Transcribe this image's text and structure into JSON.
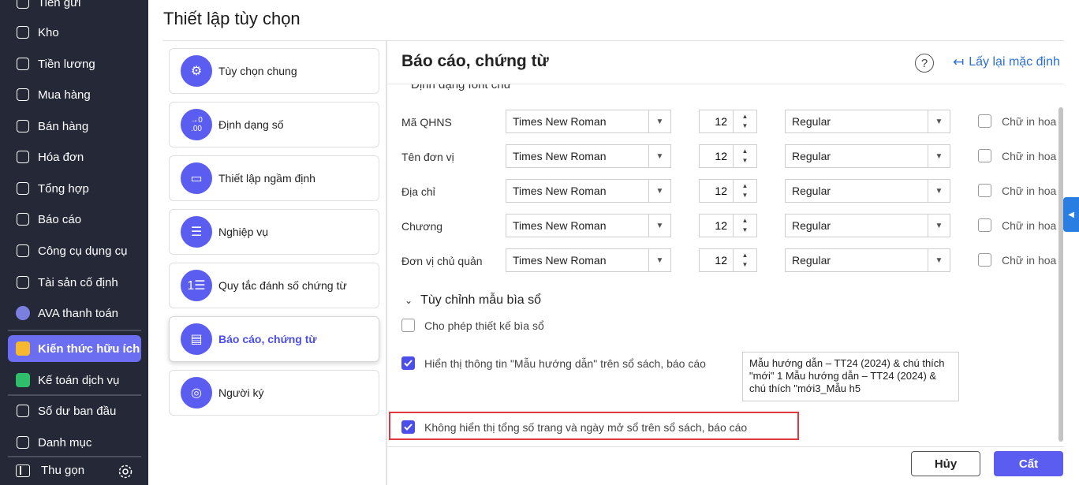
{
  "sidebar": {
    "items": [
      {
        "label": "Tiền gửi",
        "icon": "bank-icon"
      },
      {
        "label": "Kho",
        "icon": "warehouse-icon"
      },
      {
        "label": "Tiền lương",
        "icon": "salary-icon"
      },
      {
        "label": "Mua hàng",
        "icon": "cart-icon"
      },
      {
        "label": "Bán hàng",
        "icon": "store-icon"
      },
      {
        "label": "Hóa đơn",
        "icon": "invoice-icon"
      },
      {
        "label": "Tổng hợp",
        "icon": "summary-icon"
      },
      {
        "label": "Báo cáo",
        "icon": "report-icon"
      },
      {
        "label": "Công cụ dụng cụ",
        "icon": "tools-icon"
      },
      {
        "label": "Tài sản cố định",
        "icon": "asset-icon"
      },
      {
        "label": "AVA thanh toán",
        "icon": "ava-avatar-icon"
      },
      {
        "label": "Kiến thức hữu ích",
        "icon": "knowledge-icon"
      },
      {
        "label": "Kế toán dịch vụ",
        "icon": "service-icon"
      },
      {
        "label": "Số dư ban đầu",
        "icon": "balance-icon"
      },
      {
        "label": "Danh mục",
        "icon": "catalog-icon"
      }
    ],
    "collapse_label": "Thu gọn"
  },
  "page": {
    "title": "Thiết lập tùy chọn"
  },
  "menu": [
    {
      "label": "Tùy chọn chung",
      "icon": "gear-icon"
    },
    {
      "label": "Định dạng số",
      "icon": "number-format-icon"
    },
    {
      "label": "Thiết lập ngầm định",
      "icon": "drive-icon"
    },
    {
      "label": "Nghiệp vụ",
      "icon": "server-icon"
    },
    {
      "label": "Quy tắc đánh số chứng từ",
      "icon": "numbered-list-icon"
    },
    {
      "label": "Báo cáo, chứng từ",
      "icon": "document-icon"
    },
    {
      "label": "Người ký",
      "icon": "user-icon"
    }
  ],
  "panel": {
    "title": "Báo cáo, chứng từ",
    "reset_label": "Lấy lại mặc định",
    "section_cut": "Định dạng font chữ",
    "font_rows": [
      {
        "label": "Mã QHNS",
        "font": "Times New Roman",
        "size": "12",
        "style": "Regular",
        "uppercase": "Chữ in hoa"
      },
      {
        "label": "Tên đơn vị",
        "font": "Times New Roman",
        "size": "12",
        "style": "Regular",
        "uppercase": "Chữ in hoa"
      },
      {
        "label": "Địa chỉ",
        "font": "Times New Roman",
        "size": "12",
        "style": "Regular",
        "uppercase": "Chữ in hoa"
      },
      {
        "label": "Chương",
        "font": "Times New Roman",
        "size": "12",
        "style": "Regular",
        "uppercase": "Chữ in hoa"
      },
      {
        "label": "Đơn vị chủ quản",
        "font": "Times New Roman",
        "size": "12",
        "style": "Regular",
        "uppercase": "Chữ in hoa"
      }
    ],
    "section2_title": "Tùy chỉnh mẫu bìa sổ",
    "opt_cover": "Cho phép thiết kế bìa sổ",
    "opt_show_template": "Hiển thị thông tin \"Mẫu hướng dẫn\" trên sổ sách, báo cáo",
    "template_text": "Mẫu hướng dẫn – TT24 (2024) & chú thích \"mới\" 1 Mẫu hướng dẫn – TT24 (2024) & chú thích \"mới3_Mẫu h5",
    "opt_hide_pages": "Không hiển thị tổng số trang và ngày mở sổ trên sổ sách, báo cáo"
  },
  "buttons": {
    "cancel": "Hủy",
    "save": "Cất"
  },
  "colors": {
    "accent": "#5a5df0",
    "sidebar_bg": "#242837",
    "link": "#2a6fd6",
    "highlight": "#e0383f"
  }
}
